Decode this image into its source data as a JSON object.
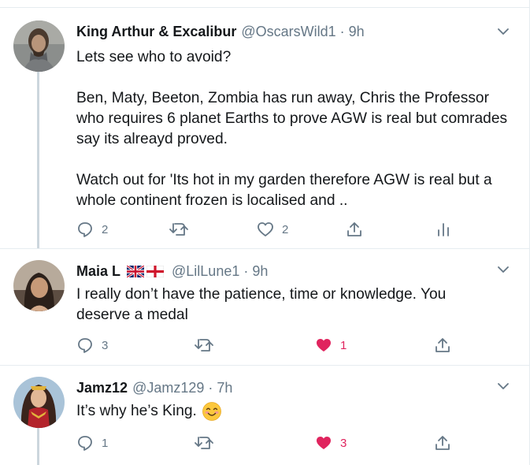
{
  "tweets": [
    {
      "name": "King Arthur & Excalibur",
      "handle": "@OscarsWild1",
      "separator": "·",
      "time": "9h",
      "paragraphs": [
        "Lets see who to avoid?",
        "Ben, Maty, Beeton, Zombia has run away, Chris the Professor who requires 6 planet Earths to prove AGW is real but comrades say its alreayd proved.",
        "Watch out for 'Its hot in my garden therefore AGW is real but a whole continent frozen is localised and .."
      ],
      "replies": "2",
      "retweets": "",
      "likes": "2",
      "liked": false
    },
    {
      "name": "Maia L",
      "handle": "@LilLune1",
      "separator": "·",
      "time": "9h",
      "flags": [
        "uk-flag-icon",
        "england-flag-icon"
      ],
      "paragraphs": [
        "I really don’t have the patience, time or knowledge. You deserve a medal"
      ],
      "replies": "3",
      "retweets": "",
      "likes": "1",
      "liked": true
    },
    {
      "name": "Jamz12",
      "handle": "@Jamz129",
      "separator": "·",
      "time": "7h",
      "paragraphs": [
        "It’s why he’s King."
      ],
      "emoji": "smiling-face-emoji",
      "replies": "1",
      "retweets": "",
      "likes": "3",
      "liked": true
    }
  ],
  "colors": {
    "text": "#14171a",
    "secondary": "#657786",
    "like": "#e0245e",
    "border": "#e6ecf0",
    "thread": "#ccd6dd"
  }
}
